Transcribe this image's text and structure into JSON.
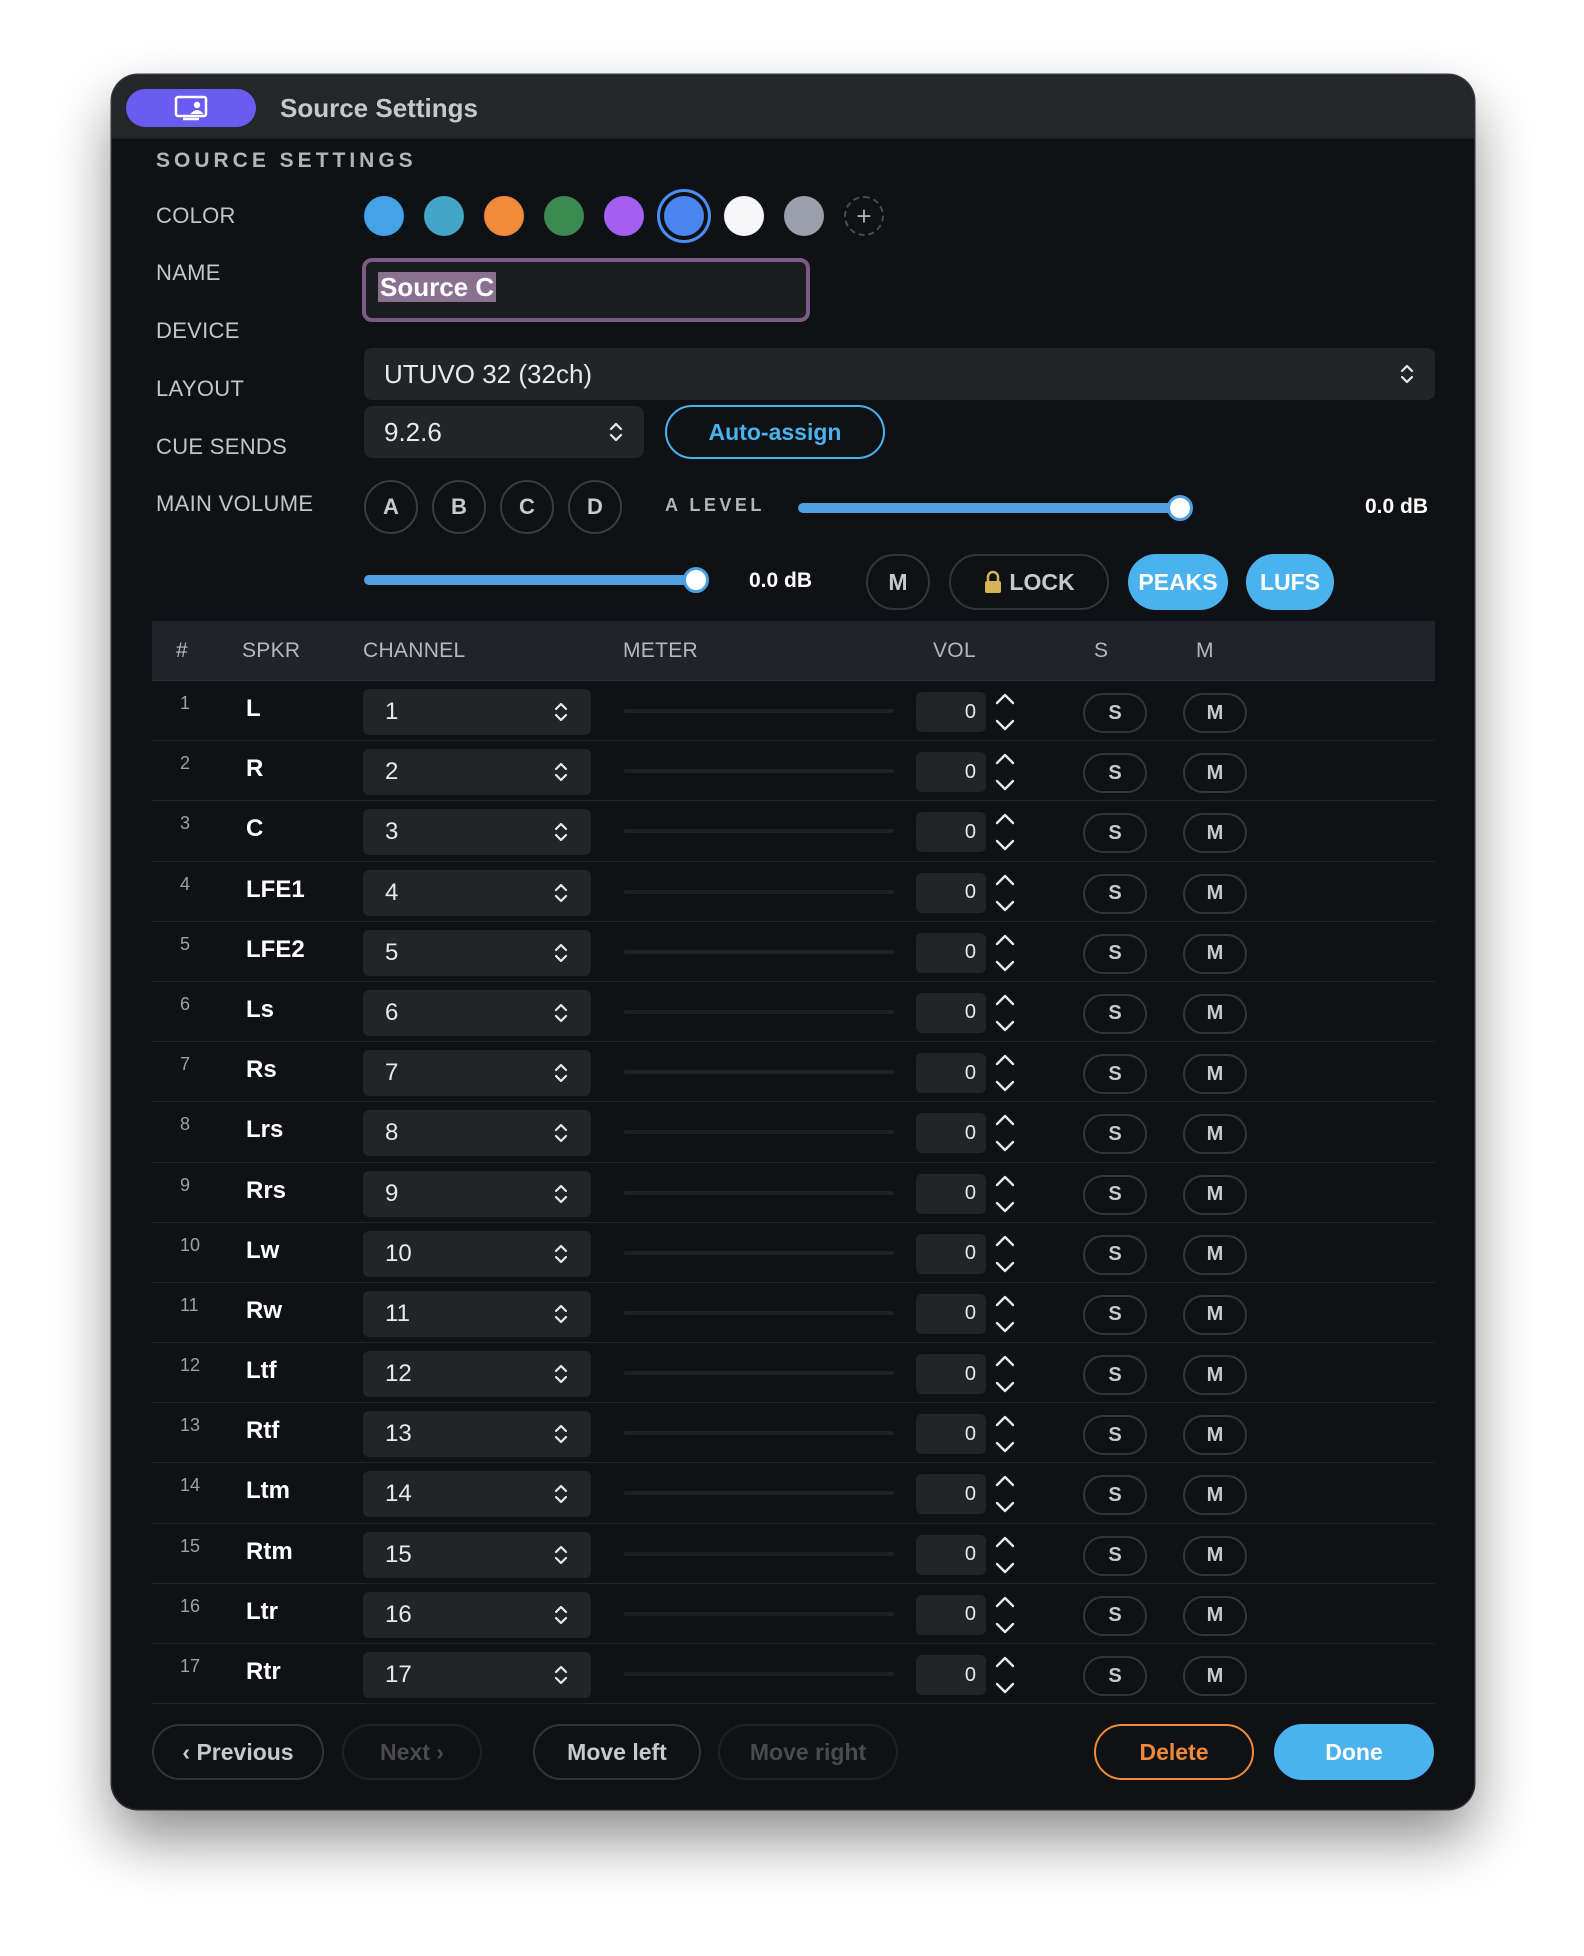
{
  "window": {
    "title": "Source Settings",
    "title_icon": "monitor-user-icon"
  },
  "section_heading": "SOURCE SETTINGS",
  "labels": {
    "color": "COLOR",
    "name": "NAME",
    "device": "DEVICE",
    "layout": "LAYOUT",
    "cue_sends": "CUE SENDS",
    "main_volume": "MAIN VOLUME"
  },
  "colors": {
    "swatches": [
      "#45a2e6",
      "#42a6c8",
      "#ef8b3a",
      "#3a8a52",
      "#a25ff0",
      "#4a86f0",
      "#f6f6f7",
      "#9aa0ab"
    ],
    "selected_index": 5,
    "accent": "#4ab2ee",
    "delete": "#ef8a3a",
    "title_pill": "#6a5cf0",
    "add_label": "+"
  },
  "name": {
    "value": "Source C"
  },
  "device": {
    "value": "UTUVO 32 (32ch)"
  },
  "layout": {
    "value": "9.2.6",
    "auto_assign": "Auto-assign"
  },
  "cue_sends": {
    "buttons": [
      "A",
      "B",
      "C",
      "D"
    ],
    "level_label": "A LEVEL",
    "level_value": "0.0 dB",
    "level_fraction": 1.0
  },
  "main_volume": {
    "value": "0.0 dB",
    "fraction": 1.0,
    "mute": "M",
    "lock": "LOCK",
    "peaks": "PEAKS",
    "lufs": "LUFS"
  },
  "table": {
    "headers": {
      "num": "#",
      "spkr": "SPKR",
      "channel": "CHANNEL",
      "meter": "METER",
      "vol": "VOL",
      "s": "S",
      "m": "M"
    },
    "rows": [
      {
        "num": "1",
        "spkr": "L",
        "channel": "1",
        "vol": "0",
        "s": "S",
        "m": "M"
      },
      {
        "num": "2",
        "spkr": "R",
        "channel": "2",
        "vol": "0",
        "s": "S",
        "m": "M"
      },
      {
        "num": "3",
        "spkr": "C",
        "channel": "3",
        "vol": "0",
        "s": "S",
        "m": "M"
      },
      {
        "num": "4",
        "spkr": "LFE1",
        "channel": "4",
        "vol": "0",
        "s": "S",
        "m": "M"
      },
      {
        "num": "5",
        "spkr": "LFE2",
        "channel": "5",
        "vol": "0",
        "s": "S",
        "m": "M"
      },
      {
        "num": "6",
        "spkr": "Ls",
        "channel": "6",
        "vol": "0",
        "s": "S",
        "m": "M"
      },
      {
        "num": "7",
        "spkr": "Rs",
        "channel": "7",
        "vol": "0",
        "s": "S",
        "m": "M"
      },
      {
        "num": "8",
        "spkr": "Lrs",
        "channel": "8",
        "vol": "0",
        "s": "S",
        "m": "M"
      },
      {
        "num": "9",
        "spkr": "Rrs",
        "channel": "9",
        "vol": "0",
        "s": "S",
        "m": "M"
      },
      {
        "num": "10",
        "spkr": "Lw",
        "channel": "10",
        "vol": "0",
        "s": "S",
        "m": "M"
      },
      {
        "num": "11",
        "spkr": "Rw",
        "channel": "11",
        "vol": "0",
        "s": "S",
        "m": "M"
      },
      {
        "num": "12",
        "spkr": "Ltf",
        "channel": "12",
        "vol": "0",
        "s": "S",
        "m": "M"
      },
      {
        "num": "13",
        "spkr": "Rtf",
        "channel": "13",
        "vol": "0",
        "s": "S",
        "m": "M"
      },
      {
        "num": "14",
        "spkr": "Ltm",
        "channel": "14",
        "vol": "0",
        "s": "S",
        "m": "M"
      },
      {
        "num": "15",
        "spkr": "Rtm",
        "channel": "15",
        "vol": "0",
        "s": "S",
        "m": "M"
      },
      {
        "num": "16",
        "spkr": "Ltr",
        "channel": "16",
        "vol": "0",
        "s": "S",
        "m": "M"
      },
      {
        "num": "17",
        "spkr": "Rtr",
        "channel": "17",
        "vol": "0",
        "s": "S",
        "m": "M"
      }
    ]
  },
  "footer": {
    "previous": "‹ Previous",
    "next": "Next ›",
    "move_left": "Move left",
    "move_right": "Move right",
    "delete": "Delete",
    "done": "Done"
  }
}
